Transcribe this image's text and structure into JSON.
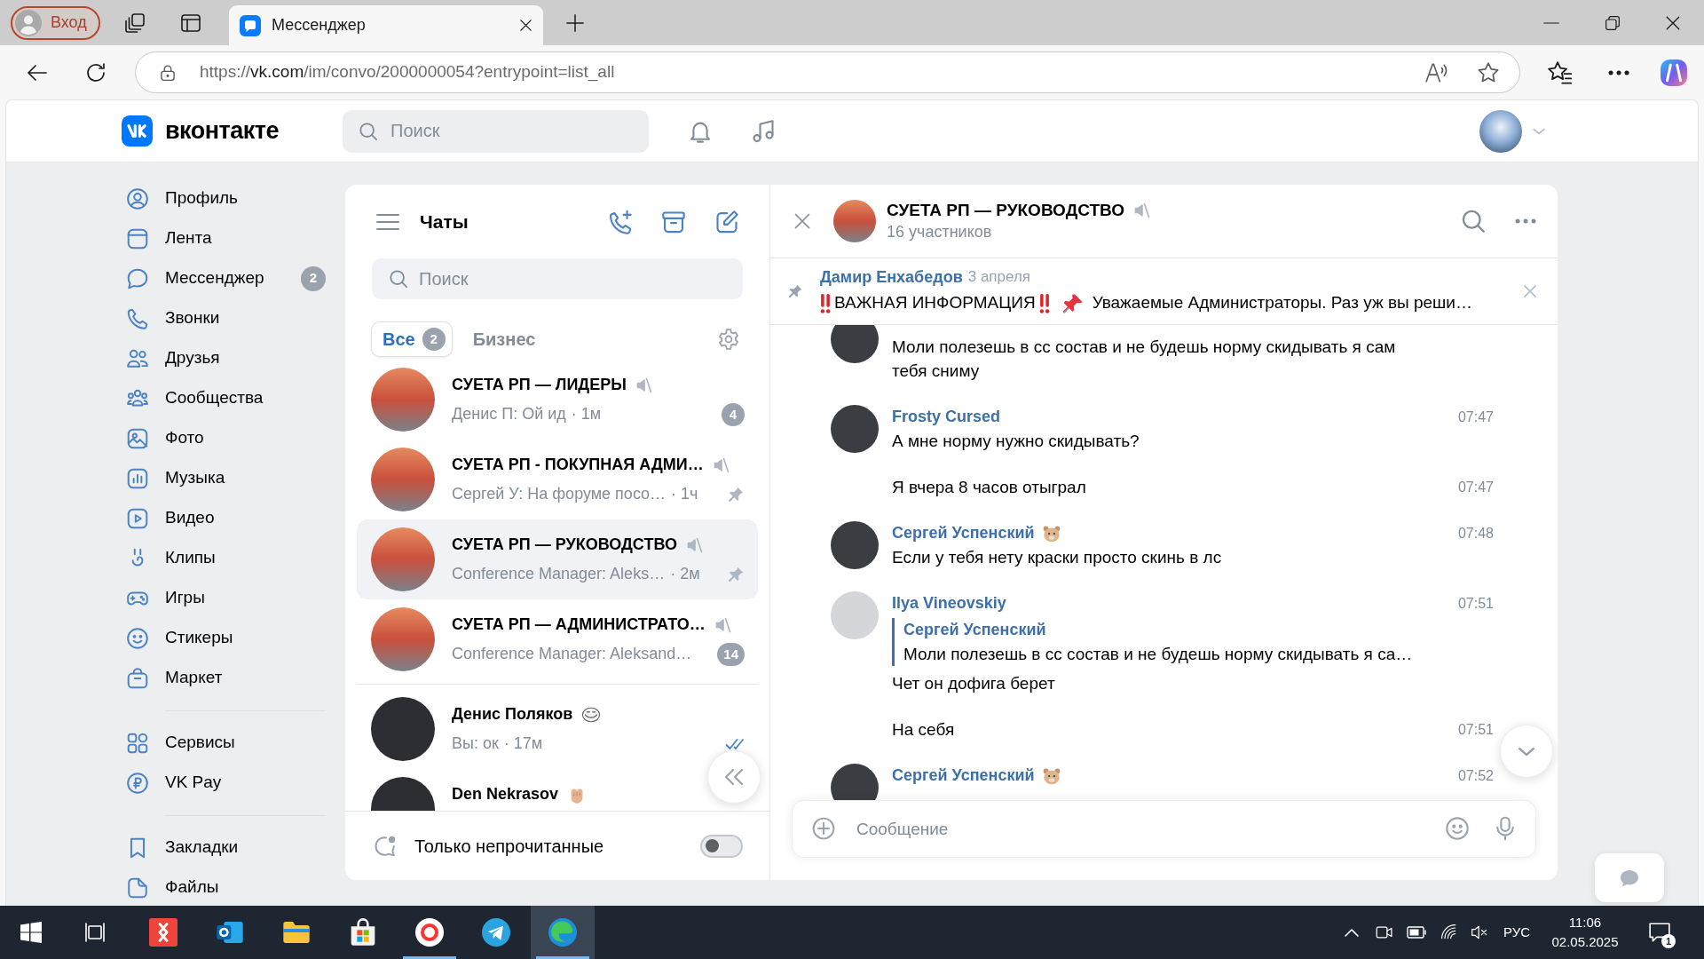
{
  "browser": {
    "profile": {
      "label": "Вход"
    },
    "tabs": [
      {
        "title": "Мессенджер",
        "selected": true
      }
    ],
    "address": {
      "scheme": "https://",
      "host": "vk.com",
      "path": "/im/convo/2000000054?entrypoint=list_all"
    }
  },
  "header": {
    "logo": "вконтакте",
    "search": {
      "placeholder": "Поиск"
    }
  },
  "nav": {
    "sections": [
      {
        "items": [
          {
            "label": "Профиль"
          },
          {
            "label": "Лента"
          },
          {
            "label": "Мессенджер",
            "badge": "2"
          },
          {
            "label": "Звонки"
          },
          {
            "label": "Друзья"
          },
          {
            "label": "Сообщества"
          },
          {
            "label": "Фото"
          },
          {
            "label": "Музыка"
          },
          {
            "label": "Видео"
          },
          {
            "label": "Клипы"
          },
          {
            "label": "Игры"
          },
          {
            "label": "Стикеры"
          },
          {
            "label": "Маркет"
          }
        ]
      },
      {
        "items": [
          {
            "label": "Сервисы"
          },
          {
            "label": "VK Pay"
          }
        ]
      },
      {
        "items": [
          {
            "label": "Закладки"
          },
          {
            "label": "Файлы"
          }
        ]
      }
    ]
  },
  "chat_list": {
    "title": "Чаты",
    "search": {
      "placeholder": "Поиск"
    },
    "filters": [
      {
        "label": "Все",
        "count": "2",
        "selected": true
      },
      {
        "label": "Бизнес",
        "selected": false
      }
    ],
    "sections": [
      {
        "chats": [
          {
            "kind": "group",
            "name": "СУЕТА РП — ЛИДЕРЫ",
            "muted": true,
            "preview": "Денис П: Ой ид",
            "time": "· 1м",
            "pinned": false,
            "unread": "4",
            "selected": false
          },
          {
            "kind": "group",
            "name": "СУЕТА РП - ПОКУПНАЯ АДМИ…",
            "muted": true,
            "preview": "Сергей У: На форуме посо…",
            "time": "· 1ч",
            "pinned": true,
            "selected": false
          },
          {
            "kind": "group",
            "name": "СУЕТА РП — РУКОВОДСТВО",
            "muted": true,
            "preview": "Conference Manager: Aleks…",
            "time": "· 2м",
            "pinned": true,
            "selected": true
          },
          {
            "kind": "group",
            "name": "СУЕТА РП — АДМИНИСТРАТО…",
            "muted": true,
            "preview": "Conference Manager: Aleksand…",
            "pinned": false,
            "unread": "14",
            "selected": false
          }
        ]
      },
      {
        "chats": [
          {
            "kind": "person",
            "name": "Денис Поляков",
            "emoji": {
              "kind": "trollface"
            },
            "muted": false,
            "preview": "Вы: ок",
            "time": "· 17м",
            "pinned": false,
            "read": true,
            "selected": false
          },
          {
            "kind": "person",
            "name": "Den Nekrasov",
            "emoji": {
              "kind": "fist"
            },
            "muted": false,
            "pinned": false,
            "selected": false
          }
        ]
      }
    ],
    "only_unread": {
      "label": "Только непрочитанные",
      "on": false
    }
  },
  "chat": {
    "title": "СУЕТА РП — РУКОВОДСТВО",
    "muted": true,
    "subtitle": "16 участников",
    "pinned": {
      "author": "Дамир Енхабедов",
      "date": "3 апреля",
      "lead": "ВАЖНАЯ ИНФОРМАЦИЯ",
      "text": "Уважаемые Администраторы. Раз уж вы реши…"
    },
    "messages": [
      {
        "kind": "clipped",
        "avatar": {
          "kind": "dark"
        },
        "text": "Моли полезешь в сс состав и не будешь норму скидывать я сам тебя сниму"
      },
      {
        "kind": "head",
        "avatar": {
          "kind": "dark"
        },
        "author": "Frosty Cursed",
        "time": "07:47",
        "text": "А мне норму нужно скидывать?"
      },
      {
        "kind": "follow",
        "time": "07:47",
        "text": "Я вчера 8 часов отыграл"
      },
      {
        "kind": "head",
        "avatar": {
          "kind": "dark"
        },
        "author": "Сергей Успенский",
        "emoji": {
          "kind": "hamster"
        },
        "time": "07:48",
        "text": "Если у тебя нету краски просто скинь в лс"
      },
      {
        "kind": "head",
        "avatar": {
          "kind": "light"
        },
        "author": "Ilya Vineovskiy",
        "time": "07:51",
        "reply": {
          "author": "Сергей Успенский",
          "text": "Моли полезешь в сс состав и не будешь норму скидывать я са…"
        },
        "text": "Чет он дофига берет"
      },
      {
        "kind": "follow",
        "time": "07:51",
        "text": "На себя"
      },
      {
        "kind": "cut",
        "avatar": {
          "kind": "dark"
        },
        "author": "Сергей Успенский",
        "emoji": {
          "kind": "hamster"
        },
        "time": "07:52"
      }
    ],
    "composer": {
      "placeholder": "Сообщение"
    }
  },
  "taskbar": {
    "apps": [
      {
        "running": false,
        "selected": false
      },
      {
        "running": false,
        "selected": false
      },
      {
        "running": false,
        "selected": false
      },
      {
        "running": false,
        "selected": false
      },
      {
        "running": true,
        "selected": false
      },
      {
        "running": false,
        "selected": false
      },
      {
        "running": true,
        "selected": true
      }
    ],
    "language": "РУС",
    "time": "11:06",
    "date": "02.05.2025",
    "notifications": "1"
  }
}
